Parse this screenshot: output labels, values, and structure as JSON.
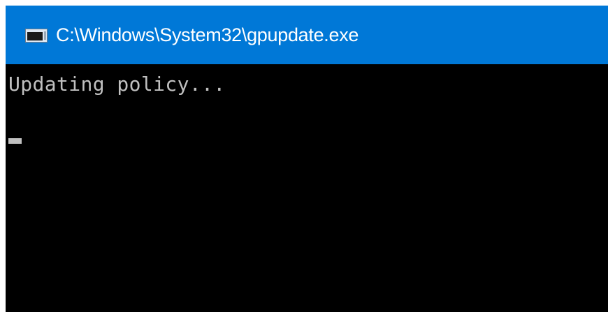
{
  "window": {
    "title": "C:\\Windows\\System32\\gpupdate.exe",
    "icon": "console-window-icon",
    "titlebar_color": "#0078d7"
  },
  "console": {
    "lines": [
      "Updating policy..."
    ],
    "text_color": "#c0c0c0",
    "background_color": "#000000"
  }
}
